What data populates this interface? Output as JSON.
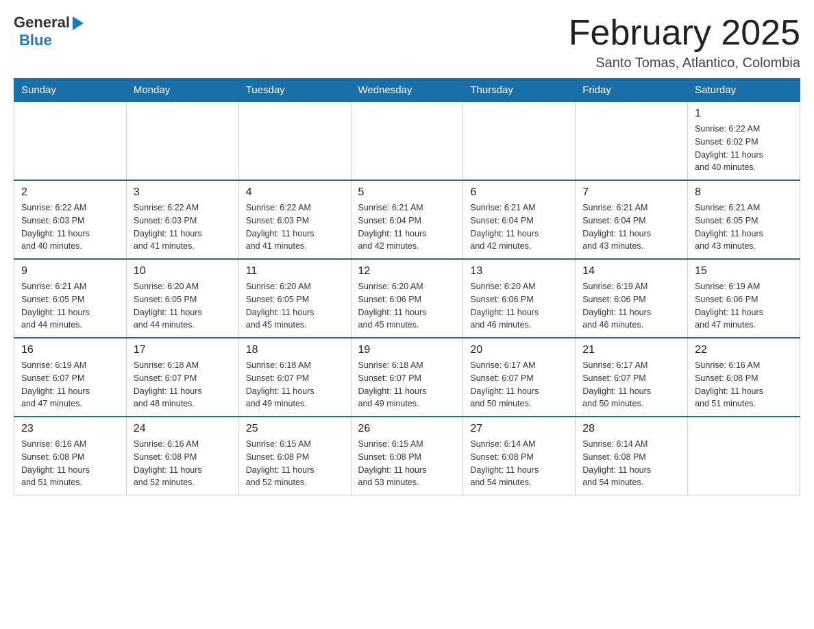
{
  "header": {
    "logo_general": "General",
    "logo_blue": "Blue",
    "month_title": "February 2025",
    "location": "Santo Tomas, Atlantico, Colombia"
  },
  "weekdays": [
    "Sunday",
    "Monday",
    "Tuesday",
    "Wednesday",
    "Thursday",
    "Friday",
    "Saturday"
  ],
  "weeks": [
    [
      {
        "day": "",
        "info": ""
      },
      {
        "day": "",
        "info": ""
      },
      {
        "day": "",
        "info": ""
      },
      {
        "day": "",
        "info": ""
      },
      {
        "day": "",
        "info": ""
      },
      {
        "day": "",
        "info": ""
      },
      {
        "day": "1",
        "info": "Sunrise: 6:22 AM\nSunset: 6:02 PM\nDaylight: 11 hours\nand 40 minutes."
      }
    ],
    [
      {
        "day": "2",
        "info": "Sunrise: 6:22 AM\nSunset: 6:03 PM\nDaylight: 11 hours\nand 40 minutes."
      },
      {
        "day": "3",
        "info": "Sunrise: 6:22 AM\nSunset: 6:03 PM\nDaylight: 11 hours\nand 41 minutes."
      },
      {
        "day": "4",
        "info": "Sunrise: 6:22 AM\nSunset: 6:03 PM\nDaylight: 11 hours\nand 41 minutes."
      },
      {
        "day": "5",
        "info": "Sunrise: 6:21 AM\nSunset: 6:04 PM\nDaylight: 11 hours\nand 42 minutes."
      },
      {
        "day": "6",
        "info": "Sunrise: 6:21 AM\nSunset: 6:04 PM\nDaylight: 11 hours\nand 42 minutes."
      },
      {
        "day": "7",
        "info": "Sunrise: 6:21 AM\nSunset: 6:04 PM\nDaylight: 11 hours\nand 43 minutes."
      },
      {
        "day": "8",
        "info": "Sunrise: 6:21 AM\nSunset: 6:05 PM\nDaylight: 11 hours\nand 43 minutes."
      }
    ],
    [
      {
        "day": "9",
        "info": "Sunrise: 6:21 AM\nSunset: 6:05 PM\nDaylight: 11 hours\nand 44 minutes."
      },
      {
        "day": "10",
        "info": "Sunrise: 6:20 AM\nSunset: 6:05 PM\nDaylight: 11 hours\nand 44 minutes."
      },
      {
        "day": "11",
        "info": "Sunrise: 6:20 AM\nSunset: 6:05 PM\nDaylight: 11 hours\nand 45 minutes."
      },
      {
        "day": "12",
        "info": "Sunrise: 6:20 AM\nSunset: 6:06 PM\nDaylight: 11 hours\nand 45 minutes."
      },
      {
        "day": "13",
        "info": "Sunrise: 6:20 AM\nSunset: 6:06 PM\nDaylight: 11 hours\nand 46 minutes."
      },
      {
        "day": "14",
        "info": "Sunrise: 6:19 AM\nSunset: 6:06 PM\nDaylight: 11 hours\nand 46 minutes."
      },
      {
        "day": "15",
        "info": "Sunrise: 6:19 AM\nSunset: 6:06 PM\nDaylight: 11 hours\nand 47 minutes."
      }
    ],
    [
      {
        "day": "16",
        "info": "Sunrise: 6:19 AM\nSunset: 6:07 PM\nDaylight: 11 hours\nand 47 minutes."
      },
      {
        "day": "17",
        "info": "Sunrise: 6:18 AM\nSunset: 6:07 PM\nDaylight: 11 hours\nand 48 minutes."
      },
      {
        "day": "18",
        "info": "Sunrise: 6:18 AM\nSunset: 6:07 PM\nDaylight: 11 hours\nand 49 minutes."
      },
      {
        "day": "19",
        "info": "Sunrise: 6:18 AM\nSunset: 6:07 PM\nDaylight: 11 hours\nand 49 minutes."
      },
      {
        "day": "20",
        "info": "Sunrise: 6:17 AM\nSunset: 6:07 PM\nDaylight: 11 hours\nand 50 minutes."
      },
      {
        "day": "21",
        "info": "Sunrise: 6:17 AM\nSunset: 6:07 PM\nDaylight: 11 hours\nand 50 minutes."
      },
      {
        "day": "22",
        "info": "Sunrise: 6:16 AM\nSunset: 6:08 PM\nDaylight: 11 hours\nand 51 minutes."
      }
    ],
    [
      {
        "day": "23",
        "info": "Sunrise: 6:16 AM\nSunset: 6:08 PM\nDaylight: 11 hours\nand 51 minutes."
      },
      {
        "day": "24",
        "info": "Sunrise: 6:16 AM\nSunset: 6:08 PM\nDaylight: 11 hours\nand 52 minutes."
      },
      {
        "day": "25",
        "info": "Sunrise: 6:15 AM\nSunset: 6:08 PM\nDaylight: 11 hours\nand 52 minutes."
      },
      {
        "day": "26",
        "info": "Sunrise: 6:15 AM\nSunset: 6:08 PM\nDaylight: 11 hours\nand 53 minutes."
      },
      {
        "day": "27",
        "info": "Sunrise: 6:14 AM\nSunset: 6:08 PM\nDaylight: 11 hours\nand 54 minutes."
      },
      {
        "day": "28",
        "info": "Sunrise: 6:14 AM\nSunset: 6:08 PM\nDaylight: 11 hours\nand 54 minutes."
      },
      {
        "day": "",
        "info": ""
      }
    ]
  ]
}
